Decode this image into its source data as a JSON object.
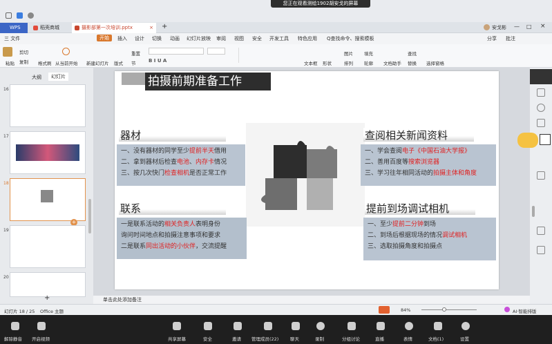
{
  "share_banner": "您正在观看测绘1902胡安戈的屏幕",
  "tabs": [
    {
      "label": "WPS"
    },
    {
      "label": "稻壳商城"
    },
    {
      "label": "摄影部第一次培训.pptx"
    }
  ],
  "user": "安戈彬",
  "menu": {
    "file": "三 文件",
    "items": [
      "开始",
      "插入",
      "设计",
      "切换",
      "动画",
      "幻灯片放映",
      "审阅",
      "视图",
      "安全",
      "开发工具",
      "特色应用"
    ],
    "search": "Q查找命令、搜索模板",
    "share": "分享",
    "comment": "批注"
  },
  "ribbon": {
    "cut": "剪切",
    "paste": "粘贴",
    "copy": "复制",
    "format_painter": "格式刷",
    "from_start": "从当前开始",
    "new_slide": "新建幻灯片",
    "layout": "版式",
    "section": "节",
    "reset": "重置",
    "textbox": "文本框",
    "shape": "形状",
    "picture": "图片",
    "fill": "填充",
    "arrange": "排列",
    "outline": "轮廓",
    "doc_helper": "文档助手",
    "find": "查找",
    "replace": "替换",
    "select_pane": "选择窗格"
  },
  "leftpane": {
    "outline_tab": "大纲",
    "slides_tab": "幻灯片",
    "thumbs": [
      "16",
      "17",
      "18",
      "19",
      "20"
    ]
  },
  "slide": {
    "title": "拍摄前期准备工作",
    "equip": {
      "heading": "器材",
      "l1a": "一、没有器材的同学至少",
      "l1r": "提前半天",
      "l1b": "借用",
      "l2a": "二、拿到器材后检查",
      "l2r1": "电池",
      "l2m": "、",
      "l2r2": "内存卡",
      "l2b": "情况",
      "l3a": "三、按几次快门",
      "l3r": "检查相机",
      "l3b": "是否正常工作"
    },
    "contact": {
      "heading": "联系",
      "l1a": "一是联系活动的",
      "l1r": "相关负责人",
      "l1b": "表明身份",
      "l2": "询问时间地点和拍摄注意事项和要求",
      "l3a": "二是联系",
      "l3r": "同出活动的小伙伴",
      "l3b": "，交流提醒"
    },
    "news": {
      "heading": "查阅相关新闻资料",
      "l1a": "一、学会查阅",
      "l1r": "电子《中国石油大学报》",
      "l2a": "二、善用百度等",
      "l2r": "搜索浏览器",
      "l3a": "三、学习往年相同活动的",
      "l3r": "拍摄主体和角度"
    },
    "arrive": {
      "heading": "提前到场调试相机",
      "l1a": "一、至少",
      "l1r": "提前二分钟",
      "l1b": "到场",
      "l2a": "二、到场后根据现场的情况",
      "l2r": "调试相机",
      "l3": "三、选取拍摄角度和拍摄点"
    }
  },
  "notes": "单击此处添加备注",
  "status": {
    "slide": "幻灯片 18 / 25",
    "theme": "Office 主题",
    "zoom": "84%",
    "ai": "AI·智能排版"
  },
  "meeting": [
    "解除静音",
    "开启视频",
    "共享屏幕",
    "安全",
    "邀请",
    "管理成员(22)",
    "聊天",
    "录制",
    "分组讨论",
    "直播",
    "表情",
    "文档(1)",
    "设置"
  ],
  "colors": {
    "accent": "#e02020",
    "box": "#b9c4d1",
    "tab_active": "#c8472f"
  }
}
